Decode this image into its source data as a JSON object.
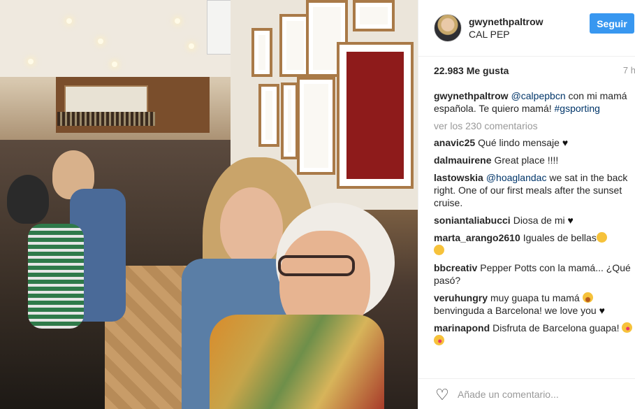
{
  "post": {
    "image_alt": "Two women smiling in a crowded tapas bar",
    "header": {
      "username": "gwynethpaltrow",
      "location": "CAL PEP",
      "follow_label": "Seguir"
    },
    "likes": "22.983 Me gusta",
    "time": "7 h",
    "caption": {
      "user": "gwynethpaltrow",
      "mention": "@calpepbcn",
      "text": " con mi mamá española. Te quiero mamá! ",
      "hashtag": "#gsporting"
    },
    "view_more": "ver los 230 comentarios",
    "comments": [
      {
        "user": "anavic25",
        "text": "Qué lindo mensaje",
        "emoji": "heart"
      },
      {
        "user": "dalmauirene",
        "text": "Great place !!!!"
      },
      {
        "user": "lastowskia",
        "mention": "@hoaglandac",
        "text": " we sat in the back right. One of our first meals after the sunset cruise."
      },
      {
        "user": "soniantaliabucci",
        "text": "Diosa de mi",
        "emoji": "heart"
      },
      {
        "user": "marta_arango2610",
        "text": "Iguales de bellas",
        "emoji": "clap"
      },
      {
        "user": "bbcreativ",
        "text": "Pepper Potts con la mamá... ¿Qué pasó?"
      },
      {
        "user": "veruhungry",
        "text": "muy guapa tu mamá",
        "emoji": "hearteyes",
        "text2": " benvinguda a Barcelona! we love you",
        "emoji2": "heart"
      },
      {
        "user": "marinapond",
        "text": "Disfruta de Barcelona guapa!",
        "emoji": "kiss"
      }
    ],
    "footer": {
      "heart_icon": "heart-outline-icon",
      "comment_placeholder": "Añade un comentario..."
    }
  }
}
